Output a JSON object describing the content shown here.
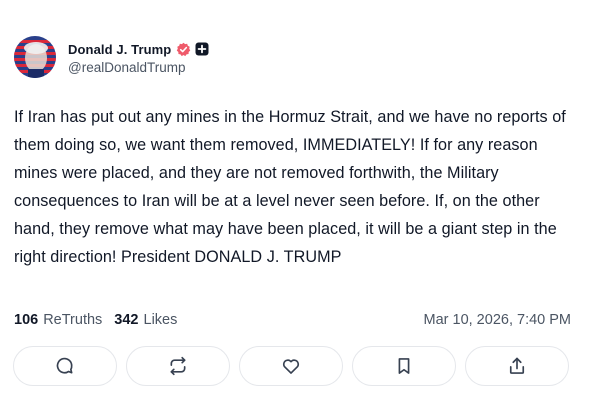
{
  "post": {
    "author": {
      "display_name": "Donald J. Trump",
      "handle": "@realDonaldTrump",
      "verified_icon": "verified-badge-icon",
      "badge_icon": "plus-badge-icon"
    },
    "text": "If Iran has put out any mines in the Hormuz Strait, and we have no reports of them doing so, we want them removed, IMMEDIATELY! If for any reason mines were placed, and they are not removed forthwith, the Military consequences to Iran will be at a level never seen before. If, on the other hand, they remove what may have been placed, it will be a giant step in the right direction! President DONALD J. TRUMP",
    "stats": {
      "retruths_count": "106",
      "retruths_label": "ReTruths",
      "likes_count": "342",
      "likes_label": "Likes"
    },
    "timestamp": "Mar 10, 2026, 7:40 PM",
    "actions": [
      {
        "name": "reply",
        "icon": "comment-icon"
      },
      {
        "name": "retruth",
        "icon": "repost-icon"
      },
      {
        "name": "like",
        "icon": "heart-icon"
      },
      {
        "name": "bookmark",
        "icon": "bookmark-icon"
      },
      {
        "name": "share",
        "icon": "share-icon"
      }
    ],
    "colors": {
      "verified_badge": "#ef5b6b",
      "text_primary": "#111827",
      "text_secondary": "#4b5563",
      "border": "#e5e7eb"
    }
  }
}
